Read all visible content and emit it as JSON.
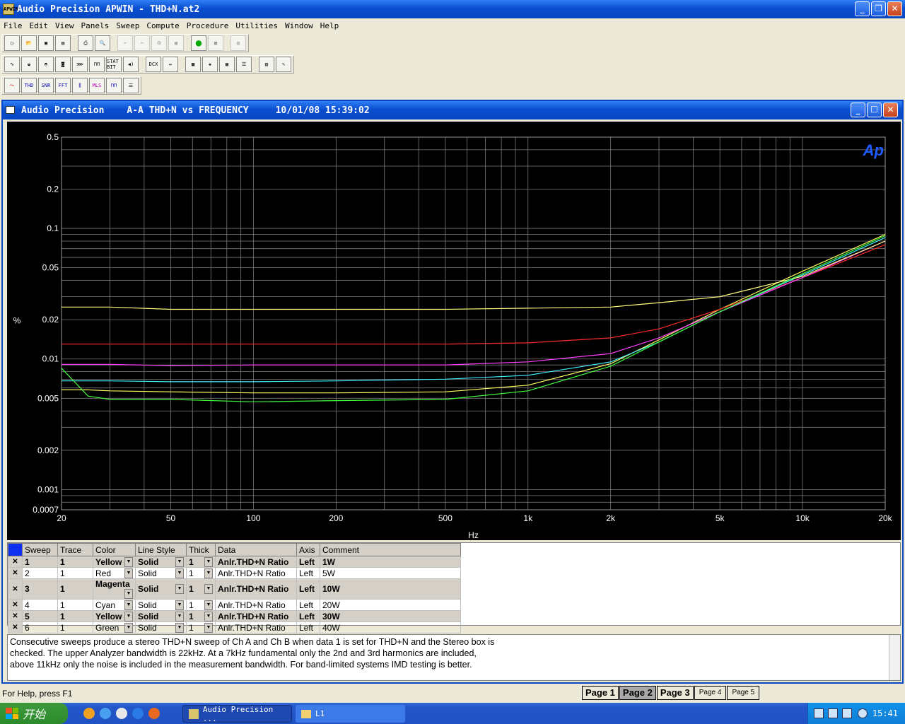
{
  "app": {
    "title": "Audio Precision APWIN  - THD+N.at2",
    "icon_label": "APWIN"
  },
  "menu": [
    "File",
    "Edit",
    "View",
    "Panels",
    "Sweep",
    "Compute",
    "Procedure",
    "Utilities",
    "Window",
    "Help"
  ],
  "toolbar_icons": {
    "row1": [
      "new-file-icon",
      "open-file-icon",
      "save-icon",
      "save-all-icon",
      "print-icon",
      "print-preview-icon",
      "undo-icon",
      "cut-icon",
      "copy-icon",
      "paste-icon",
      "go-icon",
      "stop-icon",
      "graph-icon"
    ],
    "row2": [
      "generator-icon",
      "analyzer-icon",
      "filter-icon",
      "dsp-icon",
      "sweep-icon",
      "digital-io-icon",
      "stat-bit-icon",
      "speaker-icon",
      "dcx-icon",
      "switcher-icon",
      "graph-panel-icon",
      "attach-icon",
      "table-icon",
      "data-editor-icon",
      "sweep-spectrum-icon",
      "edit-icon"
    ],
    "row2_labels": {
      "stat": "STAT BIT",
      "dcx": "DCX"
    },
    "row3": [
      "freq-response-icon",
      "thd-snr-icon",
      "snr-icon",
      "fft-icon",
      "multitone-icon",
      "mls-icon",
      "spectrum-icon",
      "list-icon"
    ],
    "row3_labels": {
      "thd": "THD",
      "snr": "SNR",
      "fft": "FFT",
      "mls": "MLS"
    }
  },
  "child_window": {
    "title_app": "Audio Precision",
    "title_graph": "A-A THD+N vs FREQUENCY",
    "title_datetime": "10/01/08 15:39:02"
  },
  "chart_data": {
    "type": "line",
    "title": "",
    "xlabel": "Hz",
    "ylabel": "%",
    "x_scale": "log",
    "y_scale": "log",
    "xlim": [
      20,
      20000
    ],
    "ylim": [
      0.0007,
      0.5
    ],
    "x_ticks": [
      20,
      50,
      100,
      200,
      500,
      1000,
      2000,
      5000,
      10000,
      20000
    ],
    "x_tick_labels": [
      "20",
      "50",
      "100",
      "200",
      "500",
      "1k",
      "2k",
      "5k",
      "10k",
      "20k"
    ],
    "y_ticks": [
      0.0007,
      0.001,
      0.002,
      0.005,
      0.01,
      0.02,
      0.05,
      0.1,
      0.2,
      0.5
    ],
    "y_tick_labels": [
      "0.0007",
      "0.001",
      "0.002",
      "0.005",
      "0.01",
      "0.02",
      "0.05",
      "0.1",
      "0.2",
      "0.5"
    ],
    "grid": true,
    "background": "#000000",
    "grid_color": "#7a7a7a",
    "logo_text": "Ap",
    "logo_color": "#1f5cff",
    "x": [
      20,
      25,
      30,
      50,
      100,
      200,
      500,
      1000,
      2000,
      3000,
      5000,
      10000,
      20000
    ],
    "series": [
      {
        "name": "1W",
        "color": "#ffff60",
        "values": [
          0.0058,
          0.0058,
          0.0057,
          0.0056,
          0.0055,
          0.0055,
          0.0056,
          0.0063,
          0.0092,
          0.014,
          0.024,
          0.047,
          0.09
        ]
      },
      {
        "name": "5W",
        "color": "#ff2a2a",
        "values": [
          0.013,
          0.013,
          0.013,
          0.013,
          0.013,
          0.013,
          0.013,
          0.0133,
          0.0145,
          0.017,
          0.024,
          0.042,
          0.075
        ]
      },
      {
        "name": "10W",
        "color": "#ff40ff",
        "values": [
          0.0091,
          0.0091,
          0.0091,
          0.0089,
          0.009,
          0.009,
          0.009,
          0.0095,
          0.011,
          0.0145,
          0.023,
          0.042,
          0.08
        ]
      },
      {
        "name": "20W",
        "color": "#40f0ff",
        "values": [
          0.0068,
          0.0068,
          0.0068,
          0.0067,
          0.0067,
          0.0068,
          0.007,
          0.0075,
          0.0095,
          0.0135,
          0.023,
          0.044,
          0.085
        ]
      },
      {
        "name": "30W",
        "color": "#ffff80",
        "values": [
          0.025,
          0.025,
          0.025,
          0.024,
          0.024,
          0.024,
          0.024,
          0.0245,
          0.025,
          0.027,
          0.03,
          0.043,
          0.08
        ]
      },
      {
        "name": "40W",
        "color": "#40ff40",
        "values": [
          0.0085,
          0.0052,
          0.0049,
          0.0049,
          0.0047,
          0.0048,
          0.0049,
          0.0057,
          0.0088,
          0.0135,
          0.023,
          0.045,
          0.088
        ]
      }
    ]
  },
  "sweep_table": {
    "headers": [
      "Sweep",
      "Trace",
      "Color",
      "Line Style",
      "Thick",
      "Data",
      "Axis",
      "Comment"
    ],
    "rows": [
      {
        "sweep": "1",
        "trace": "1",
        "color": "Yellow",
        "style": "Solid",
        "thick": "1",
        "data": "Anlr.THD+N Ratio",
        "axis": "Left",
        "comment": "1W",
        "bold": true
      },
      {
        "sweep": "2",
        "trace": "1",
        "color": "Red",
        "style": "Solid",
        "thick": "1",
        "data": "Anlr.THD+N Ratio",
        "axis": "Left",
        "comment": "5W",
        "bold": false
      },
      {
        "sweep": "3",
        "trace": "1",
        "color": "Magenta",
        "style": "Solid",
        "thick": "1",
        "data": "Anlr.THD+N Ratio",
        "axis": "Left",
        "comment": "10W",
        "bold": true
      },
      {
        "sweep": "4",
        "trace": "1",
        "color": "Cyan",
        "style": "Solid",
        "thick": "1",
        "data": "Anlr.THD+N Ratio",
        "axis": "Left",
        "comment": "20W",
        "bold": false
      },
      {
        "sweep": "5",
        "trace": "1",
        "color": "Yellow",
        "style": "Solid",
        "thick": "1",
        "data": "Anlr.THD+N Ratio",
        "axis": "Left",
        "comment": "30W",
        "bold": true
      },
      {
        "sweep": "6",
        "trace": "1",
        "color": "Green",
        "style": "Solid",
        "thick": "1",
        "data": "Anlr.THD+N Ratio",
        "axis": "Left",
        "comment": "40W",
        "bold": false
      }
    ]
  },
  "notes": [
    "Consecutive sweeps produce a stereo THD+N sweep of Ch A and Ch B when data 1 is set for THD+N and the Stereo box is",
    "checked.  The upper Analyzer bandwidth is 22kHz.  At a 7kHz fundamental only the 2nd and 3rd harmonics are included,",
    "above 11kHz only the noise is included in the measurement bandwidth.  For band-limited systems IMD testing is better."
  ],
  "status": {
    "help": "For Help, press F1",
    "pages": [
      "Page 1",
      "Page 2",
      "Page 3",
      "Page 4",
      "Page 5"
    ],
    "selected_page": "Page 2"
  },
  "taskbar": {
    "start": "开始",
    "tasks": [
      "Audio Precision ...",
      "L1"
    ],
    "clock": "15:41"
  }
}
